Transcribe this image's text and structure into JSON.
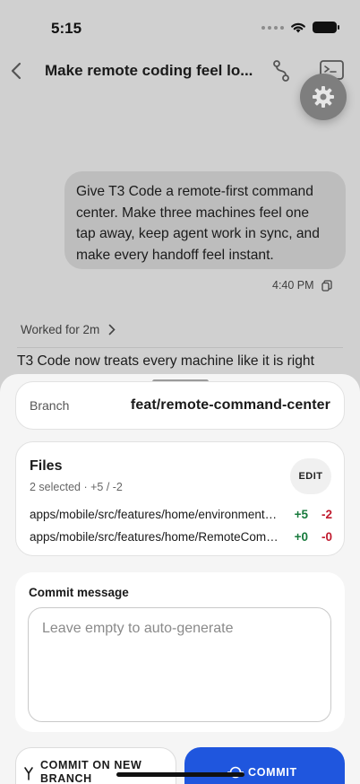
{
  "status_bar": {
    "time": "5:15"
  },
  "nav": {
    "title": "Make remote coding feel lo..."
  },
  "chat": {
    "user_message_lines": [
      "Give T3 Code a remote-first command",
      "center. Make three machines feel one",
      "tap away, keep agent work in sync, and",
      "make every handoff feel instant."
    ],
    "timestamp": "4:40 PM",
    "worked_label": "Worked for 2m",
    "assistant_preview": "T3 Code now treats every machine like it is right"
  },
  "sheet": {
    "branch": {
      "label": "Branch",
      "value": "feat/remote-command-center"
    },
    "files": {
      "title": "Files",
      "summary": "2 selected · +5 / -2",
      "edit_label": "EDIT",
      "items": [
        {
          "path": "apps/mobile/src/features/home/environmentHelpers.ts",
          "additions": "+5",
          "deletions": "-2"
        },
        {
          "path": "apps/mobile/src/features/home/RemoteCommandCenter.tsx",
          "additions": "+0",
          "deletions": "-0"
        }
      ]
    },
    "commit": {
      "title": "Commit message",
      "placeholder": "Leave empty to auto-generate",
      "value": ""
    },
    "actions": {
      "new_branch_label": "COMMIT ON NEW BRANCH",
      "commit_label": "COMMIT"
    }
  },
  "colors": {
    "accent": "#1f56de",
    "additions": "#177a3c",
    "deletions": "#c01a2e"
  }
}
